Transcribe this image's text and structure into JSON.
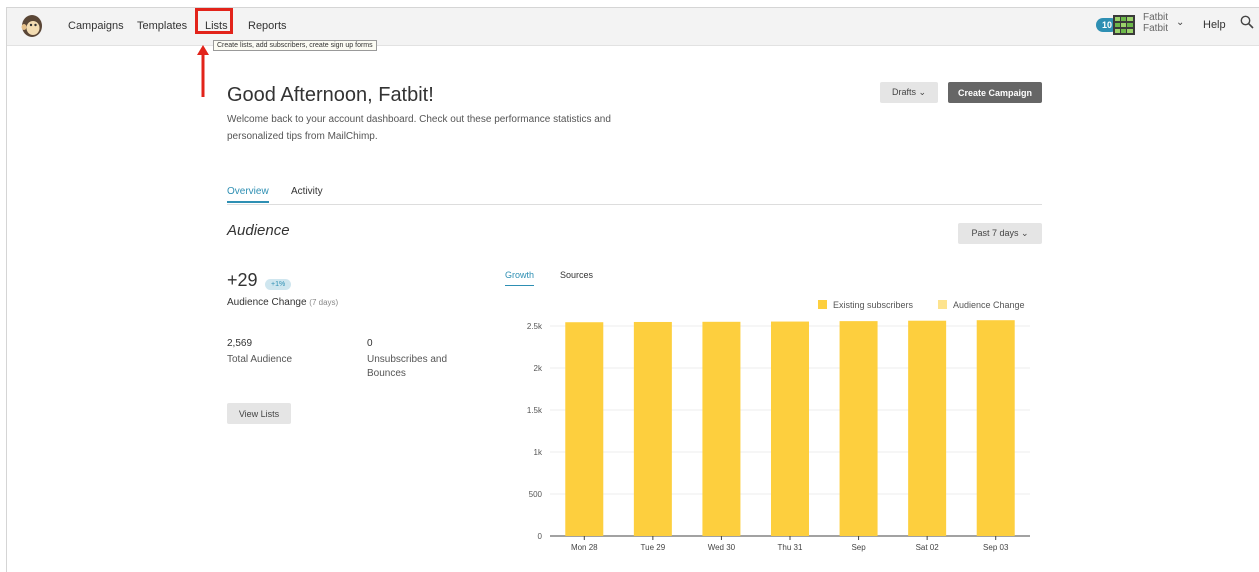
{
  "nav": {
    "items": [
      "Campaigns",
      "Templates",
      "Lists",
      "Reports"
    ],
    "tooltip": "Create lists, add subscribers, create sign up forms",
    "badge_count": "10",
    "user_name": "Fatbit",
    "user_sub": "Fatbit",
    "help": "Help"
  },
  "header": {
    "greeting": "Good Afternoon, Fatbit!",
    "welcome": "Welcome back to your account dashboard. Check out these performance statistics and personalized tips from MailChimp.",
    "drafts": "Drafts ⌄",
    "create_campaign": "Create Campaign"
  },
  "tabs": {
    "overview": "Overview",
    "activity": "Activity"
  },
  "audience": {
    "title": "Audience",
    "period_button": "Past 7 days ⌄",
    "change_value": "+29",
    "change_pill": "+1%",
    "change_label": "Audience Change",
    "change_period": "(7 days)",
    "total_value": "2,569",
    "total_label": "Total Audience",
    "unsub_value": "0",
    "unsub_label": "Unsubscribes and Bounces",
    "view_lists": "View Lists"
  },
  "chart_tabs": {
    "growth": "Growth",
    "sources": "Sources"
  },
  "colors": {
    "existing": "#fdcf3e",
    "change": "#fde38e",
    "accent": "#2e8fb3"
  },
  "chart_data": {
    "type": "bar",
    "categories": [
      "Mon 28",
      "Tue 29",
      "Wed 30",
      "Thu 31",
      "Sep",
      "Sat 02",
      "Sep 03"
    ],
    "series": [
      {
        "name": "Existing subscribers",
        "values": [
          2545,
          2548,
          2550,
          2553,
          2558,
          2563,
          2569
        ]
      },
      {
        "name": "Audience Change",
        "values": [
          0,
          0,
          0,
          0,
          0,
          0,
          0
        ]
      }
    ],
    "yticks": [
      "0",
      "500",
      "1k",
      "1.5k",
      "2k",
      "2.5k"
    ],
    "ylim": [
      0,
      2500
    ],
    "legend": "top-right"
  }
}
